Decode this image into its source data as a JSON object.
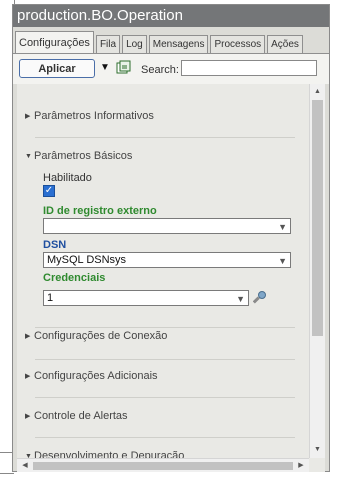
{
  "window": {
    "title": "production.BO.Operation"
  },
  "tabs": [
    {
      "label": "Configurações",
      "active": true
    },
    {
      "label": "Fila"
    },
    {
      "label": "Log"
    },
    {
      "label": "Mensagens"
    },
    {
      "label": "Processos"
    },
    {
      "label": "Ações"
    }
  ],
  "toolbar": {
    "apply_label": "Aplicar",
    "filter_icon": "filter-icon",
    "refresh_icon": "refresh-icon",
    "search_label": "Search:",
    "search_value": ""
  },
  "sections": {
    "informativos": {
      "label": "Parâmetros Informativos",
      "expanded": false
    },
    "basicos": {
      "label": "Parâmetros Básicos",
      "expanded": true
    },
    "conexao": {
      "label": "Configurações de Conexão",
      "expanded": false
    },
    "adicionais": {
      "label": "Configurações Adicionais",
      "expanded": false
    },
    "alertas": {
      "label": "Controle de Alertas",
      "expanded": false
    },
    "depuracao": {
      "label": "Desenvolvimento e Depuração",
      "expanded": true
    }
  },
  "basic_params": {
    "habilitado_label": "Habilitado",
    "habilitado_checked": true,
    "id_registro_label": "ID de registro externo",
    "id_registro_value": "",
    "dsn_label": "DSN",
    "dsn_value": "MySQL DSNsys",
    "credenciais_label": "Credenciais",
    "credenciais_value": "1"
  },
  "colors": {
    "titlebar": "#747678",
    "green_label": "#2f8a2f",
    "blue_label": "#1f4fa0",
    "checkbox": "#2a6fd1"
  }
}
